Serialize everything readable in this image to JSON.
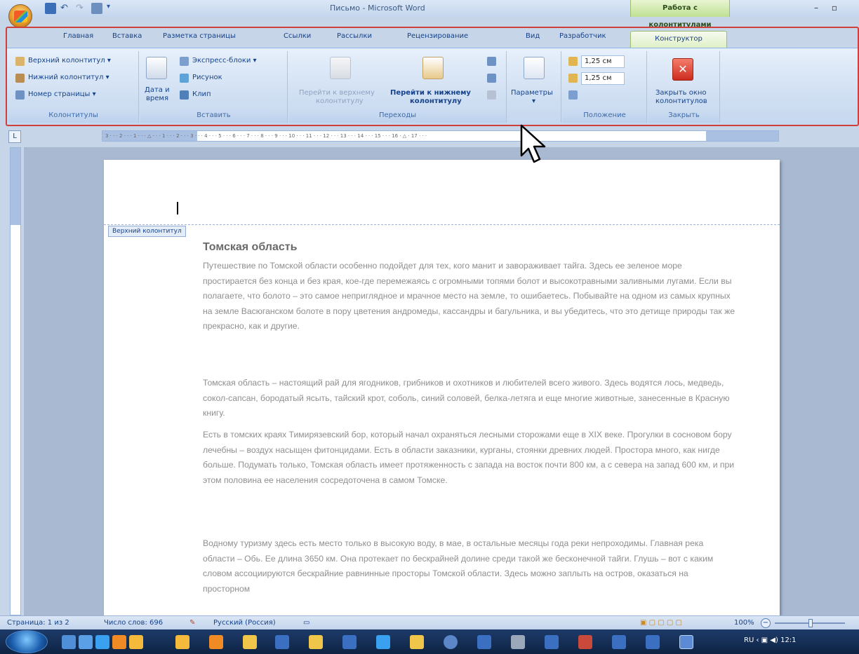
{
  "window": {
    "title": "Письмо - Microsoft Word",
    "context_tab": "Работа с колонтитулами",
    "minimize": "–",
    "maximize": "▫"
  },
  "tabs": [
    "Главная",
    "Вставка",
    "Разметка страницы",
    "Ссылки",
    "Рассылки",
    "Рецензирование",
    "Вид",
    "Разработчик"
  ],
  "active_tab": "Конструктор",
  "ribbon": {
    "group_headers_footers": {
      "title": "Колонтитулы",
      "header_btn": "Верхний колонтитул ▾",
      "footer_btn": "Нижний колонтитул ▾",
      "page_number_btn": "Номер страницы ▾"
    },
    "group_insert": {
      "title": "Вставить",
      "datetime_line1": "Дата и",
      "datetime_line2": "время",
      "quick_parts_btn": "Экспресс-блоки ▾",
      "picture_btn": "Рисунок",
      "clip_btn": "Клип"
    },
    "group_navigation": {
      "title": "Переходы",
      "goto_header_line1": "Перейти к верхнему",
      "goto_header_line2": "колонтитулу",
      "goto_footer_line1": "Перейти к нижнему",
      "goto_footer_line2": "колонтитулу"
    },
    "group_options": {
      "label": "Параметры",
      "arrow": "▾"
    },
    "group_position": {
      "title": "Положение",
      "header_from_top": "1,25 см",
      "footer_from_bottom": "1,25 см"
    },
    "group_close": {
      "title": "Закрыть",
      "close_line1": "Закрыть окно",
      "close_line2": "колонтитулов"
    }
  },
  "ruler": {
    "corner_icon": "L",
    "ticks": "3 · · · 2 · · · 1 · · · △ · · · 1 · · · 2 · · · 3 · · · 4 · · · 5 · · · 6 · · · 7 · · · 8 · · · 9 · · · 10 · · · 11 · · · 12 · · · 13 · · · 14 · · · 15 · · · 16 · △ · 17 · · ·"
  },
  "document": {
    "header_label": "Верхний колонтитул",
    "heading": "Томская область",
    "paragraphs": [
      "Путешествие по Томской области особенно подойдет для тех, кого манит и завораживает тайга. Здесь ее зеленое море простирается без конца и без края, кое-где перемежаясь с огромными топями болот и высокотравными заливными лугами. Если вы полагаете, что болото – это самое неприглядное и мрачное место на земле, то ошибаетесь. Побывайте на одном из самых крупных на земле Васюганском болоте в пору цветения андромеды, кассандры и багульника, и вы убедитесь, что это детище природы так же прекрасно, как и другие.",
      "Томская область – настоящий рай для ягодников, грибников и охотников и любителей всего живого. Здесь водятся лось, медведь, сокол-сапсан, бородатый ясыть, тайский крот, соболь, синий соловей, белка-летяга и еще многие животные, занесенные в Красную книгу.",
      "Есть в томских краях Тимирязевский бор, который начал охраняться лесными сторожами еще в XIX веке. Прогулки в сосновом бору лечебны – воздух насыщен фитонцидами. Есть в области заказники, курганы, стоянки древних людей. Простора много, как нигде больше. Подумать только, Томская область имеет протяженность с запада на восток почти 800 км, а с севера на запад 600 км, и при этом половина ее населения сосредоточена в самом Томске.",
      "Водному туризму здесь есть место только в высокую воду, в мае, в остальные месяцы года реки непроходимы. Главная река области – Обь. Ее длина 3650 км. Она протекает по бескрайней долине среди такой же бесконечной тайги. Глушь – вот с каким словом ассоциируются бескрайние равнинные просторы Томской области. Здесь можно заплыть на остров, оказаться на просторном"
    ]
  },
  "status": {
    "page": "Страница: 1 из 2",
    "words": "Число слов: 696",
    "language": "Русский (Россия)",
    "zoom": "100%",
    "zoom_out": "−"
  },
  "taskbar": {
    "tray_lang": "RU",
    "clock": "12:1"
  },
  "colors": {
    "highlight": "#d0403a",
    "context_tab": "#bfe093",
    "ribbon": "#d1e0f3"
  }
}
